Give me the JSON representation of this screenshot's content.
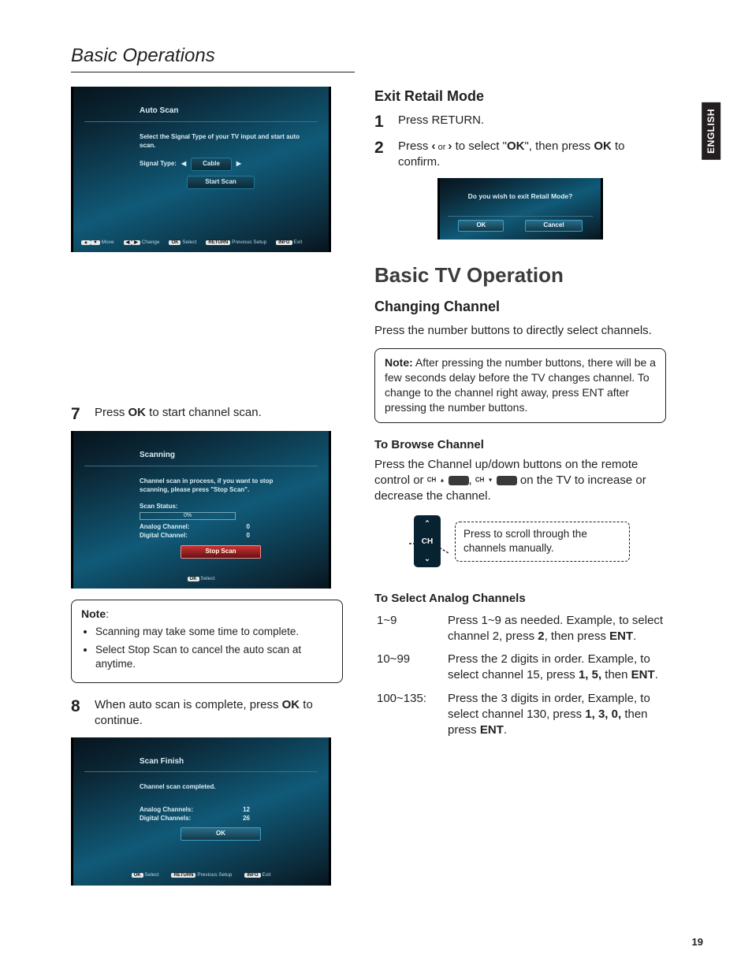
{
  "header": "Basic Operations",
  "lang_tab": "ENGLISH",
  "page_number": "19",
  "tv_autoscan": {
    "title": "Auto Scan",
    "instruction": "Select the Signal Type of your TV input and start auto scan.",
    "signal_label": "Signal Type:",
    "signal_value": "Cable",
    "start_label": "Start Scan",
    "footer": {
      "move": "Move",
      "change": "Change",
      "ok": "OK",
      "select": "Select",
      "ret": "RETURN",
      "prev": "Previous Setup",
      "info": "INFO",
      "exit": "Exit"
    }
  },
  "step7": {
    "num": "7",
    "text_pre": "Press ",
    "ok": "OK",
    "text_post": " to start channel scan."
  },
  "tv_scanning": {
    "title": "Scanning",
    "instruction": "Channel scan in process, if you want to stop scanning, please press \"Stop Scan\".",
    "status_label": "Scan Status:",
    "percent": "0%",
    "analog_label": "Analog Channel:",
    "analog_val": "0",
    "digital_label": "Digital Channel:",
    "digital_val": "0",
    "stop": "Stop Scan",
    "footer_ok": "OK",
    "footer_select": "Select"
  },
  "note_scan": {
    "title": "Note",
    "items": [
      "Scanning may take some time to complete.",
      "Select Stop Scan to cancel the auto scan at anytime."
    ]
  },
  "step8": {
    "num": "8",
    "pre": "When auto scan is complete, press ",
    "ok": "OK",
    "post": " to continue."
  },
  "tv_finish": {
    "title": "Scan Finish",
    "msg": "Channel scan completed.",
    "analog_label": "Analog Channels:",
    "analog_val": "12",
    "digital_label": "Digital Channels:",
    "digital_val": "26",
    "ok": "OK",
    "footer": {
      "ok": "OK",
      "select": "Select",
      "ret": "RETURN",
      "prev": "Previous Setup",
      "info": "INFO",
      "exit": "Exit"
    }
  },
  "exit_retail": {
    "heading": "Exit Retail Mode",
    "s1n": "1",
    "s1": "Press RETURN.",
    "s2n": "2",
    "s2_pre": "Press ",
    "s2_or": " or ",
    "s2_mid": " to select \"",
    "s2_okq": "OK",
    "s2_mid2": "\", then press  ",
    "s2_ok": "OK",
    "s2_post": " to confirm."
  },
  "tv_exit": {
    "q": "Do you wish to exit Retail Mode?",
    "ok": "OK",
    "cancel": "Cancel"
  },
  "basic_tv": {
    "heading": "Basic TV Operation",
    "changing_heading": "Changing Channel",
    "changing_text": "Press the number buttons to directly select channels.",
    "note_title": "Note:",
    "note_text": " After pressing the number buttons, there will be a few seconds delay before the TV changes channel. To change to the channel right away, press ENT after pressing the number buttons.",
    "browse_heading": "To Browse Channel",
    "browse_pre": "Press the Channel up/down buttons on the remote control or ",
    "browse_ch1": "CH",
    "browse_sep": ", ",
    "browse_ch2": "CH",
    "browse_post": " on the TV to increase or decrease the channel.",
    "ch_label": "CH",
    "callout": "Press to scroll through the channels manually.",
    "analog_heading": "To Select Analog Channels",
    "rows": [
      {
        "range": "1~9",
        "pre": "Press 1~9 as needed. Example, to select channel 2, press ",
        "k1": "2",
        "mid": ", then press ",
        "k2": "ENT",
        "post": "."
      },
      {
        "range": "10~99",
        "pre": "Press the 2 digits in order. Example, to select channel 15, press ",
        "k1": "1, 5,",
        "mid": " then ",
        "k2": "ENT",
        "post": "."
      },
      {
        "range": "100~135:",
        "pre": "Press the 3 digits in order, Example, to select channel 130, press ",
        "k1": "1, 3, 0,",
        "mid": "  then press ",
        "k2": "ENT",
        "post": "."
      }
    ]
  }
}
